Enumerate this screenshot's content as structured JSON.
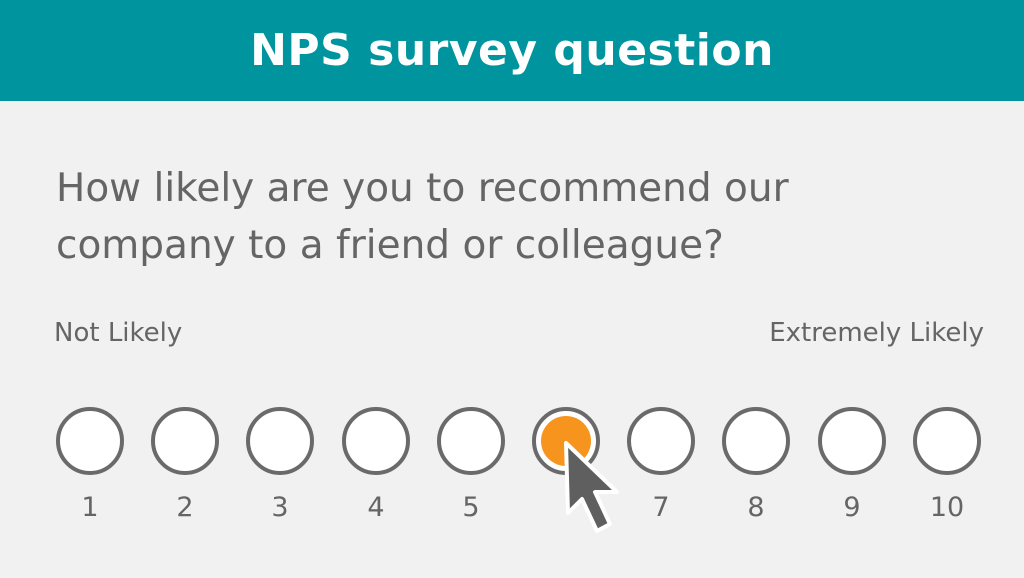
{
  "header": {
    "title": "NPS survey question"
  },
  "question": {
    "text": "How likely are you to recommend our\ncompany to a friend or colleague?"
  },
  "scale": {
    "low_label": "Not Likely",
    "high_label": "Extremely Likely",
    "options": [
      {
        "value": 1,
        "label": "1",
        "selected": false
      },
      {
        "value": 2,
        "label": "2",
        "selected": false
      },
      {
        "value": 3,
        "label": "3",
        "selected": false
      },
      {
        "value": 4,
        "label": "4",
        "selected": false
      },
      {
        "value": 5,
        "label": "5",
        "selected": false
      },
      {
        "value": 6,
        "label": "",
        "selected": true
      },
      {
        "value": 7,
        "label": "7",
        "selected": false
      },
      {
        "value": 8,
        "label": "8",
        "selected": false
      },
      {
        "value": 9,
        "label": "9",
        "selected": false
      },
      {
        "value": 10,
        "label": "10",
        "selected": false
      }
    ]
  },
  "colors": {
    "header_bg": "#00949f",
    "selected_fill": "#f7941d",
    "cursor_fill": "#5f5f5f"
  },
  "icons": {
    "cursor": "mouse-pointer-icon"
  }
}
